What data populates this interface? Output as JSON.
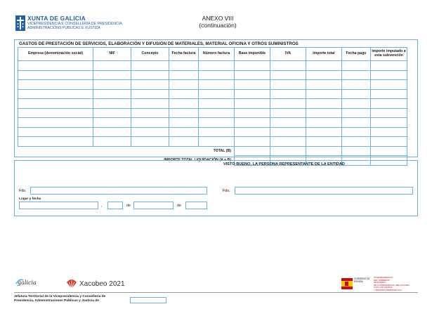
{
  "header": {
    "org_name": "XUNTA DE GALICIA",
    "dept_line1": "VICEPRESIDENCIA E CONSELLERÍA DE PRESIDENCIA,",
    "dept_line2": "ADMINISTRACIÓNS PÚBLICAS E XUSTIZA",
    "anexo_line1": "ANEXO VIII",
    "anexo_line2": "(continuación)"
  },
  "section_gastos": {
    "title": "GASTOS DE PRESTACIÓN DE SERVICIOS, ELABORACIÓN Y DIFUSIÓN DE MATERIALES, MATERIAL OFICINA Y OTROS SUMINISTROS",
    "columns": [
      "Empresa (denominación social)",
      "NIF",
      "Concepto",
      "Fecha factura",
      "Número factura",
      "Base imponible",
      "IVA",
      "Importe total",
      "Fecha pago",
      "Importe imputado a esta subvención"
    ],
    "empty_rows": 9,
    "total_b_label": "TOTAL (B)",
    "total_liquidacion_label": "IMPORTE TOTAL LIQUIDACIÓN (A + B)"
  },
  "section_visto": {
    "title": "VISTO BUENO, LA PERSONA REPRESENTANTE DE LA ENTIDAD",
    "fdo_left": "Fdo.",
    "fdo_right": "Fdo.",
    "lugar_fecha": "Lugar y fecha",
    "comma": ",",
    "de1": "de",
    "de2": "de"
  },
  "footer": {
    "galicia_brand": "galicia",
    "xacobeo_brand": "Xacobeo 2021",
    "spain_ministry_line1": "VICEPRESIDENCIA",
    "spain_ministry_line2": "DEL GOBIERNO",
    "spain_ministry_line3": "MINISTERIO",
    "spain_ministry_line4": "DE LA PRESIDENCIA, RELACIONES CON LAS CORTES",
    "spain_ministry_line5": "Y MEMORIA DEMOCRÁTICA",
    "spain_gobierno": "GOBIERNO DE ESPAÑA",
    "jefatura_text": "Jefatura Territorial de la Vicepresidencia y Consellería de Presidencia, Administraciones Públicas y Justicia de"
  },
  "colors": {
    "border": "#6ab3e0",
    "brand_blue": "#1f5fa8"
  }
}
